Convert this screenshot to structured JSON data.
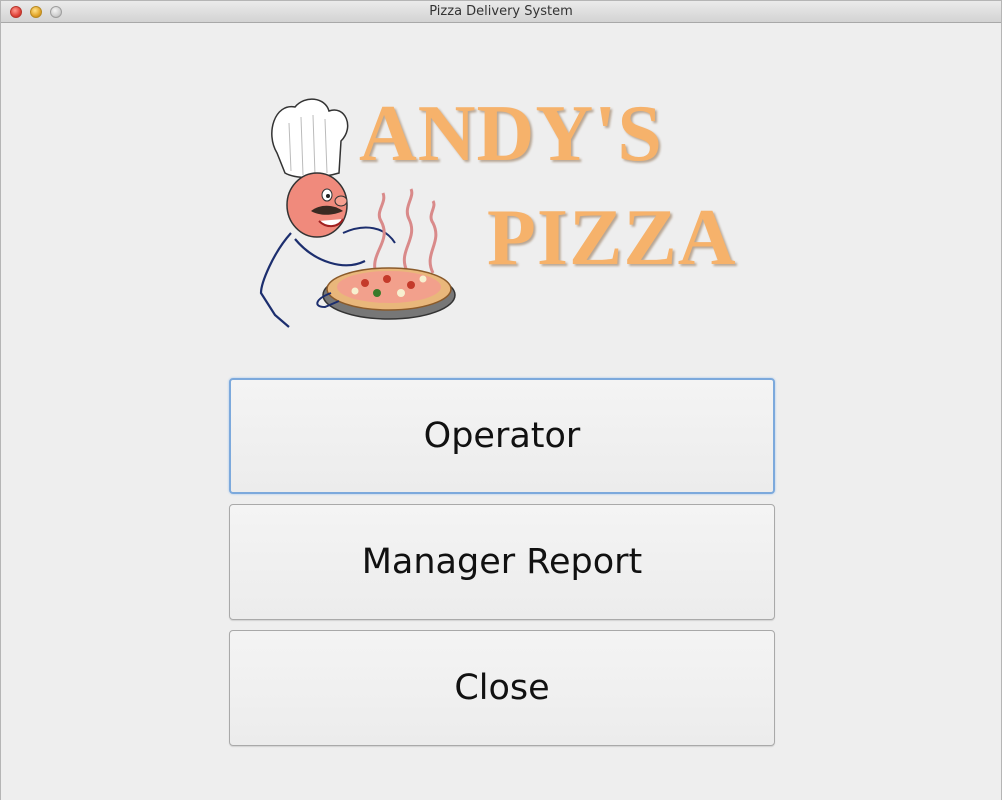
{
  "window": {
    "title": "Pizza Delivery System",
    "controls": [
      "close-icon",
      "minimize-icon",
      "zoom-icon"
    ]
  },
  "logo": {
    "line1": "ANDY'S",
    "line2": "PIZZA",
    "color": "#f6b26b",
    "image": "chef-holding-pizza"
  },
  "buttons": {
    "operator": "Operator",
    "manager_report": "Manager Report",
    "close": "Close"
  },
  "focus_color": "#7ca9dc"
}
